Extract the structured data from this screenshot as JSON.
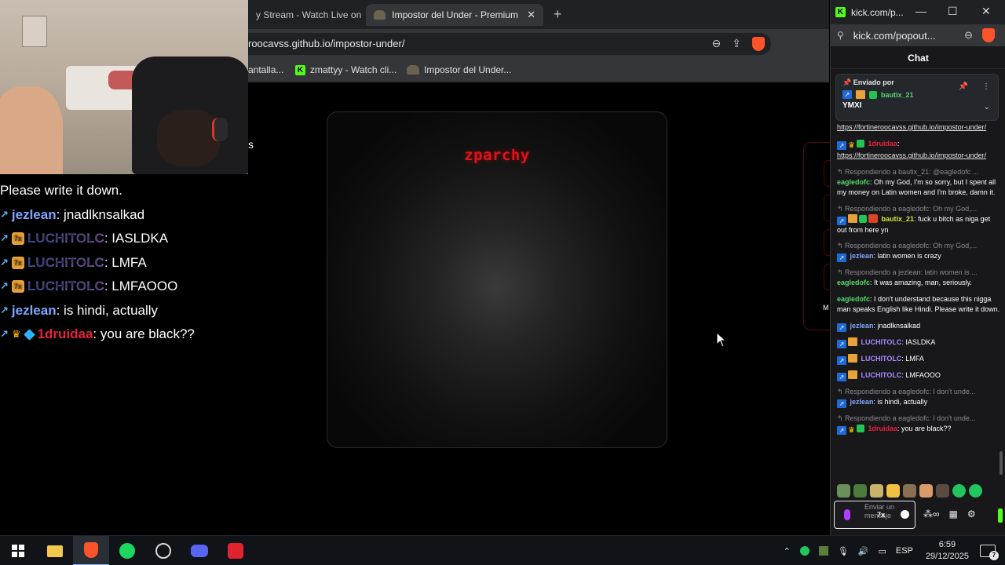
{
  "browser": {
    "tabs": [
      {
        "label": "y Stream - Watch Live on K"
      },
      {
        "label": "Impostor del Under - Premium B"
      }
    ],
    "url": "roocavss.github.io/impostor-under/",
    "bookmarks": [
      {
        "label": "antalla..."
      },
      {
        "label": "zmattyy - Watch cli..."
      },
      {
        "label": "Impostor del Under..."
      }
    ]
  },
  "page": {
    "title": "zparchy",
    "side_label": "M"
  },
  "webcam_side_text": "s",
  "stream_chat": [
    {
      "user": "",
      "text": "Please write it down."
    },
    {
      "user": "jezlean",
      "text": ": jnadlknsalkad",
      "badges": [
        "sword"
      ],
      "color": "blue"
    },
    {
      "user": "LUCHITOLC",
      "text": ": IASLDKA",
      "badges": [
        "sword",
        "sub"
      ],
      "sub": "7x",
      "color": "grad"
    },
    {
      "user": "LUCHITOLC",
      "text": ": LMFA",
      "badges": [
        "sword",
        "sub"
      ],
      "sub": "7x",
      "color": "grad"
    },
    {
      "user": "LUCHITOLC",
      "text": ": LMFAOOO",
      "badges": [
        "sword",
        "sub"
      ],
      "sub": "7x",
      "color": "grad"
    },
    {
      "user": "jezlean",
      "text": ": is hindi, actually",
      "badges": [
        "sword"
      ],
      "color": "blue"
    },
    {
      "user": "1druidaa",
      "text": ": you are black??",
      "badges": [
        "sword",
        "crown",
        "gem"
      ],
      "color": "red"
    }
  ],
  "popout": {
    "title": "kick.com/p...",
    "url": "kick.com/popout...",
    "chat_header": "Chat",
    "pinned": {
      "header": "Enviado por",
      "user": "bautix_21",
      "message": "YMXI"
    },
    "messages": [
      {
        "type": "link",
        "text": "https://fortineroocavss.github.io/impostor-under/"
      },
      {
        "type": "msg",
        "user": "1druidaa",
        "sep": ": ",
        "text": "",
        "link": "https://fortineroocavss.github.io/impostor-under/",
        "color": "red"
      },
      {
        "type": "reply",
        "text": "Respondiendo a bautix_21: @eagledofc ..."
      },
      {
        "type": "msg",
        "user": "eagledofc",
        "sep": ": ",
        "text": "Oh my God, I'm so sorry, but I spent all my money on Latin women and I'm broke, damn it.",
        "color": "green"
      },
      {
        "type": "reply",
        "text": "Respondiendo a eagledofc: Oh my God,..."
      },
      {
        "type": "msg",
        "user": "bautix_21",
        "sep": ": ",
        "text": "fuck u bitch as niga get out from here yn",
        "color": "yellow"
      },
      {
        "type": "reply",
        "text": "Respondiendo a eagledofc: Oh my God,..."
      },
      {
        "type": "msg",
        "user": "jezlean",
        "sep": ": ",
        "text": "latin women is crazy",
        "color": "blue"
      },
      {
        "type": "reply",
        "text": "Respondiendo a jezlean: latin women is ..."
      },
      {
        "type": "msg",
        "user": "eagledofc",
        "sep": ": ",
        "text": "It was amazing, man, seriously.",
        "color": "green"
      },
      {
        "type": "msg",
        "user": "eagledofc",
        "sep": ": ",
        "text": "I don't understand because this nigga man speaks English like Hindi. Please write it down.",
        "color": "green"
      },
      {
        "type": "msg",
        "user": "jezlean",
        "sep": ": ",
        "text": "jnadlknsalkad",
        "color": "blue"
      },
      {
        "type": "msg",
        "user": "LUCHITOLC",
        "sep": ": ",
        "text": "IASLDKA",
        "color": "purple"
      },
      {
        "type": "msg",
        "user": "LUCHITOLC",
        "sep": ": ",
        "text": "LMFA",
        "color": "purple"
      },
      {
        "type": "msg",
        "user": "LUCHITOLC",
        "sep": ": ",
        "text": "LMFAOOO",
        "color": "purple"
      },
      {
        "type": "reply",
        "text": "Respondiendo a eagledofc: I don't unde..."
      },
      {
        "type": "msg",
        "user": "jezlean",
        "sep": ": ",
        "text": "is hindi, actually",
        "color": "blue"
      },
      {
        "type": "reply",
        "text": "Respondiendo a eagledofc: I don't unde..."
      },
      {
        "type": "msg",
        "user": "1druidaa",
        "sep": ": ",
        "text": "you are black??",
        "color": "red"
      }
    ],
    "input_placeholder": "Enviar un mensaje",
    "sub_badge": "7x"
  },
  "taskbar": {
    "lang": "ESP",
    "time": "6:59",
    "date": "29/12/2025",
    "notifications": "7"
  },
  "colors": {
    "kick_green": "#53fc18",
    "title_red": "#e0141a",
    "brave_orange": "#fb542b"
  }
}
